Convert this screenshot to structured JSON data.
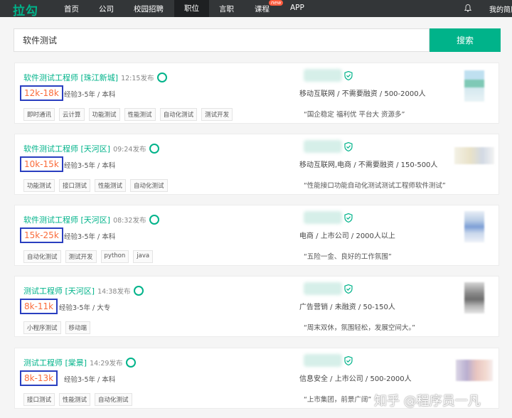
{
  "nav": {
    "logo": "拉勾",
    "items": [
      "首页",
      "公司",
      "校园招聘",
      "职位",
      "言职",
      "课程",
      "APP"
    ],
    "new_badge": "new",
    "my_link": "我的简历"
  },
  "search": {
    "value": "软件测试",
    "button_label": "搜索"
  },
  "jobs": [
    {
      "title": "软件测试工程师 [珠江新城]",
      "time": "12:15发布",
      "salary": "12k-18k",
      "exp": "经验3-5年 / 本科",
      "company_info": "移动互联网 / 不需要融资 / 500-2000人",
      "tags": [
        "即时通讯",
        "云计算",
        "功能测试",
        "性能测试",
        "自动化测试",
        "测试开发"
      ],
      "benefit": "“国企稳定 福利优 平台大 资源多”"
    },
    {
      "title": "软件测试工程师 [天河区]",
      "time": "09:24发布",
      "salary": "10k-15k",
      "exp": "经验3-5年 / 本科",
      "company_info": "移动互联网,电商 / 不需要融资 / 150-500人",
      "tags": [
        "功能测试",
        "接口测试",
        "性能测试",
        "自动化测试"
      ],
      "benefit": "“性能接口功能自动化测试测试工程师软件测试”"
    },
    {
      "title": "软件测试工程师 [天河区]",
      "time": "08:32发布",
      "salary": "15k-25k",
      "exp": "经验3-5年 / 本科",
      "company_info": "电商 / 上市公司 / 2000人以上",
      "tags": [
        "自动化测试",
        "测试开发",
        "python",
        "java"
      ],
      "benefit": "“五险一金、良好的工作氛围”"
    },
    {
      "title": "测试工程师 [天河区]",
      "time": "14:38发布",
      "salary": "8k-11k",
      "exp": "经验3-5年 / 大专",
      "company_info": "广告营销 / 未融资 / 50-150人",
      "tags": [
        "小程序测试",
        "移动端"
      ],
      "benefit": "“周末双休，氛围轻松，发展空间大。”"
    },
    {
      "title": "测试工程师 [棠景]",
      "time": "14:29发布",
      "salary": "8k-13k",
      "exp": "经验3-5年 / 本科",
      "company_info": "信息安全 / 上市公司 / 500-2000人",
      "tags": [
        "接口测试",
        "性能测试",
        "自动化测试"
      ],
      "benefit": "“上市集团，前景广阔”"
    }
  ],
  "watermark": "知乎 @程序员一凡",
  "colors": {
    "accent": "#00b38a",
    "salary": "#fa6b3a",
    "highlight_box": "#2a3fc0",
    "topbar": "#333638"
  }
}
